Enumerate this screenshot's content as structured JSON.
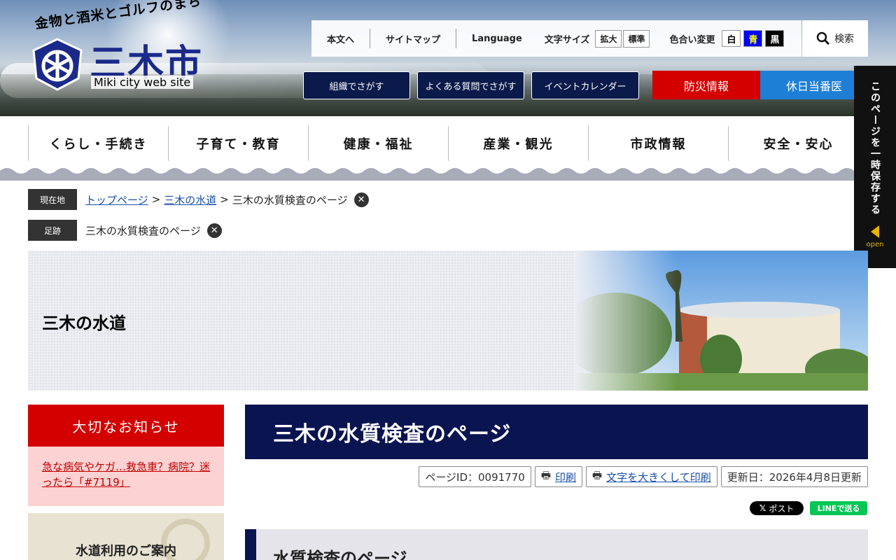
{
  "header": {
    "tagline": "金物と酒米とゴルフのまち",
    "city_name": "三木市",
    "website_label": "Miki city web site",
    "utility": {
      "honbun": "本文へ",
      "sitemap": "サイトマップ",
      "language": "Language",
      "font_size_label": "文字サイズ",
      "font_size_large": "拡大",
      "font_size_standard": "標準",
      "color_label": "色合い変更",
      "color_white": "白",
      "color_blue": "青",
      "color_black": "黒"
    },
    "search_label": "検索",
    "nav_buttons": [
      "組織でさがす",
      "よくある質問でさがす",
      "イベントカレンダー"
    ],
    "bousai": "防災情報",
    "kyujitsu": "休日当番医"
  },
  "colors": {
    "navy": "#0a1450",
    "red": "#d40000",
    "blue": "#1e7fd6",
    "accent_blue_btn": "#0000ff"
  },
  "global_nav": [
    "くらし・手続き",
    "子育て・教育",
    "健康・福祉",
    "産業・観光",
    "市政情報",
    "安全・安心"
  ],
  "save_panel": {
    "text": "このページを一時保存する",
    "open": "open"
  },
  "breadcrumb": {
    "current_tag": "現在地",
    "links": [
      "トップページ",
      "三木の水道"
    ],
    "separator": ">",
    "current": "三木の水質検査のページ",
    "history_tag": "足跡",
    "history_item": "三木の水質検査のページ"
  },
  "banner": {
    "title": "三木の水道"
  },
  "sidebar": {
    "notice_title": "大切なお知らせ",
    "notice_link": "急な病気やケガ…救急車？病院？迷ったら「#7119」",
    "guide_title": "水道利用のご案内"
  },
  "main": {
    "title": "三木の水質検査のページ",
    "page_id": "ページID：0091770",
    "print": "印刷",
    "print_large": "文字を大きくして印刷",
    "updated": "更新日：2026年4月8日更新",
    "x_post": "ポスト",
    "line_send": "LINEで送る",
    "subheading": "水質検査のページ"
  }
}
